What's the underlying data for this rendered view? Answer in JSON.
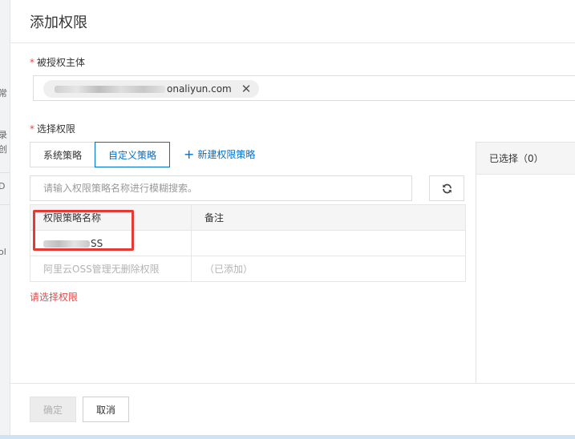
{
  "background": {
    "fragments": [
      "常",
      "录",
      "创",
      "D",
      "ol"
    ]
  },
  "dialog": {
    "title": "添加权限",
    "principal": {
      "label": "被授权主体",
      "required_mark": "*",
      "tag_visible_text": "onaliyun.com",
      "tag_close": "✕"
    },
    "permission": {
      "label": "选择权限",
      "required_mark": "*",
      "tabs": [
        {
          "label": "系统策略",
          "active": false
        },
        {
          "label": "自定义策略",
          "active": true
        }
      ],
      "new_policy_plus": "+",
      "new_policy_label": "新建权限策略",
      "search_placeholder": "请输入权限策略名称进行模糊搜索。",
      "table": {
        "headers": [
          "权限策略名称",
          "备注"
        ],
        "rows": [
          {
            "name_suffix": "SS",
            "note": ""
          },
          {
            "name": "阿里云OSS管理无删除权限",
            "note": "（已添加）"
          }
        ]
      },
      "error": "请选择权限",
      "selected_label": "已选择（0）"
    },
    "footer": {
      "ok_label": "确定",
      "cancel_label": "取消"
    }
  }
}
